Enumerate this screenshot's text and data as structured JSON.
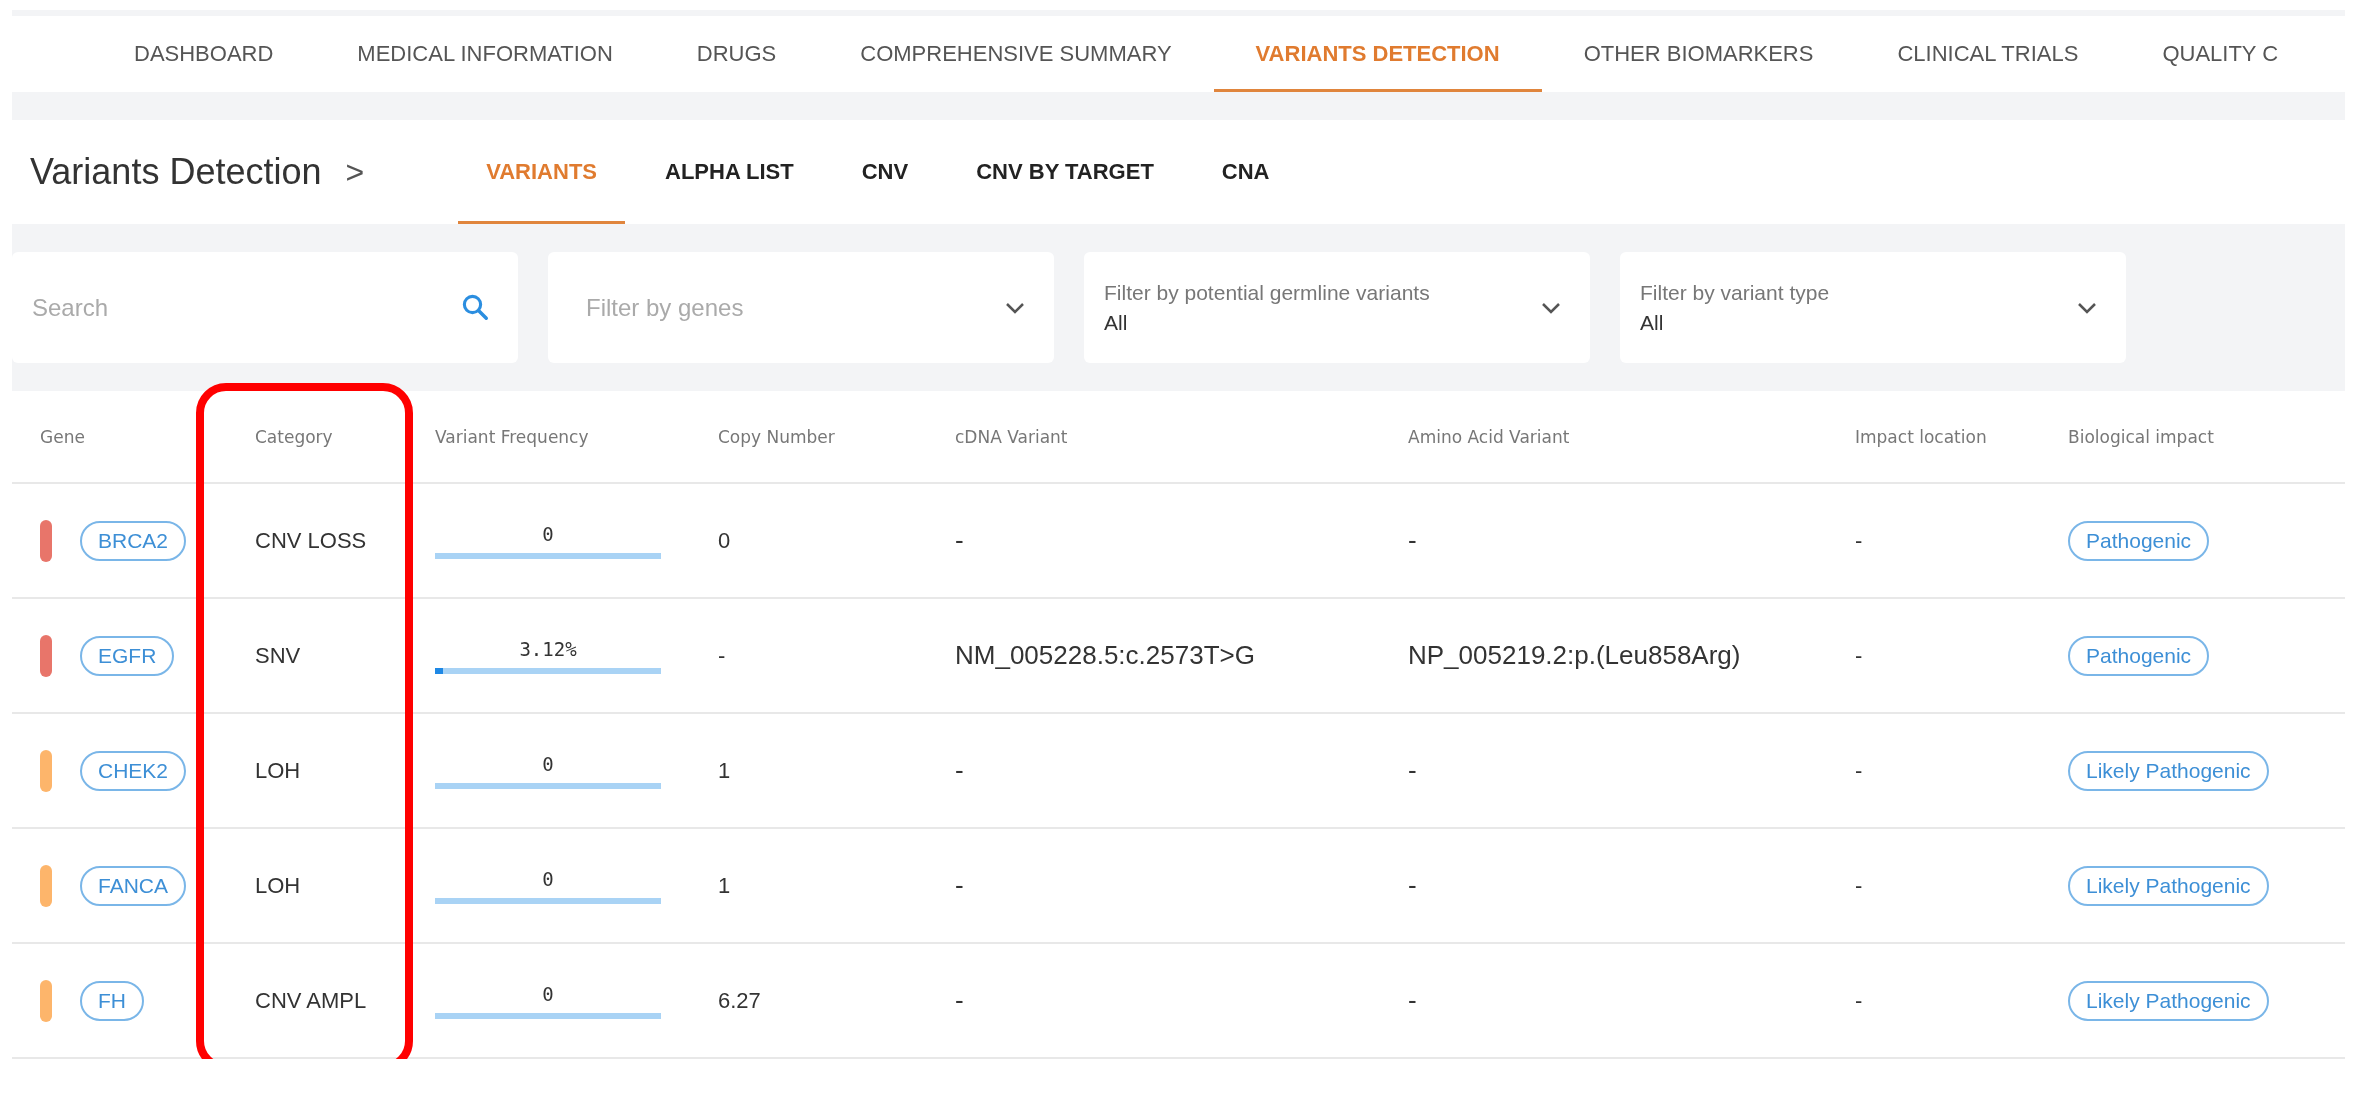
{
  "main_tabs": [
    {
      "label": "DASHBOARD",
      "selected": false
    },
    {
      "label": "MEDICAL INFORMATION",
      "selected": false
    },
    {
      "label": "DRUGS",
      "selected": false
    },
    {
      "label": "COMPREHENSIVE SUMMARY",
      "selected": false
    },
    {
      "label": "VARIANTS DETECTION",
      "selected": true
    },
    {
      "label": "OTHER BIOMARKERS",
      "selected": false
    },
    {
      "label": "CLINICAL TRIALS",
      "selected": false
    },
    {
      "label": "QUALITY C",
      "selected": false
    }
  ],
  "section": {
    "title": "Variants Detection",
    "chevron": ">"
  },
  "sub_tabs": [
    {
      "label": "VARIANTS",
      "selected": true
    },
    {
      "label": "ALPHA LIST",
      "selected": false
    },
    {
      "label": "CNV",
      "selected": false
    },
    {
      "label": "CNV BY TARGET",
      "selected": false
    },
    {
      "label": "CNA",
      "selected": false
    }
  ],
  "search": {
    "placeholder": "Search"
  },
  "filters": [
    {
      "placeholder": "Filter by genes"
    },
    {
      "label": "Filter by potential germline variants",
      "value": "All"
    },
    {
      "label": "Filter by variant type",
      "value": "All"
    }
  ],
  "table": {
    "columns": [
      "Gene",
      "Category",
      "Variant Frequency",
      "Copy Number",
      "cDNA Variant",
      "Amino Acid Variant",
      "Impact location",
      "Biological impact"
    ],
    "rows": [
      {
        "color": "#e8756a",
        "gene": "BRCA2",
        "category": "CNV LOSS",
        "frequency": "0",
        "copy_number": "0",
        "cdna": "-",
        "amino_acid": "-",
        "impact_location": "-",
        "biological_impact": "Pathogenic"
      },
      {
        "color": "#e8756a",
        "gene": "EGFR",
        "category": "SNV",
        "frequency": "3.12%",
        "level": 0.0312,
        "copy_number": "-",
        "cdna": "NM_005228.5:c.2573T>G",
        "amino_acid": "NP_005219.2:p.(Leu858Arg)",
        "impact_location": "-",
        "biological_impact": "Pathogenic"
      },
      {
        "color": "#fdb56b",
        "gene": "CHEK2",
        "category": "LOH",
        "frequency": "0",
        "copy_number": "1",
        "cdna": "-",
        "amino_acid": "-",
        "impact_location": "-",
        "biological_impact": "Likely Pathogenic"
      },
      {
        "color": "#fdb56b",
        "gene": "FANCA",
        "category": "LOH",
        "frequency": "0",
        "copy_number": "1",
        "cdna": "-",
        "amino_acid": "-",
        "impact_location": "-",
        "biological_impact": "Likely Pathogenic"
      },
      {
        "color": "#fdb56b",
        "gene": "FH",
        "category": "CNV AMPL",
        "frequency": "0",
        "copy_number": "6.27",
        "cdna": "-",
        "amino_acid": "-",
        "impact_location": "-",
        "biological_impact": "Likely Pathogenic"
      }
    ]
  }
}
